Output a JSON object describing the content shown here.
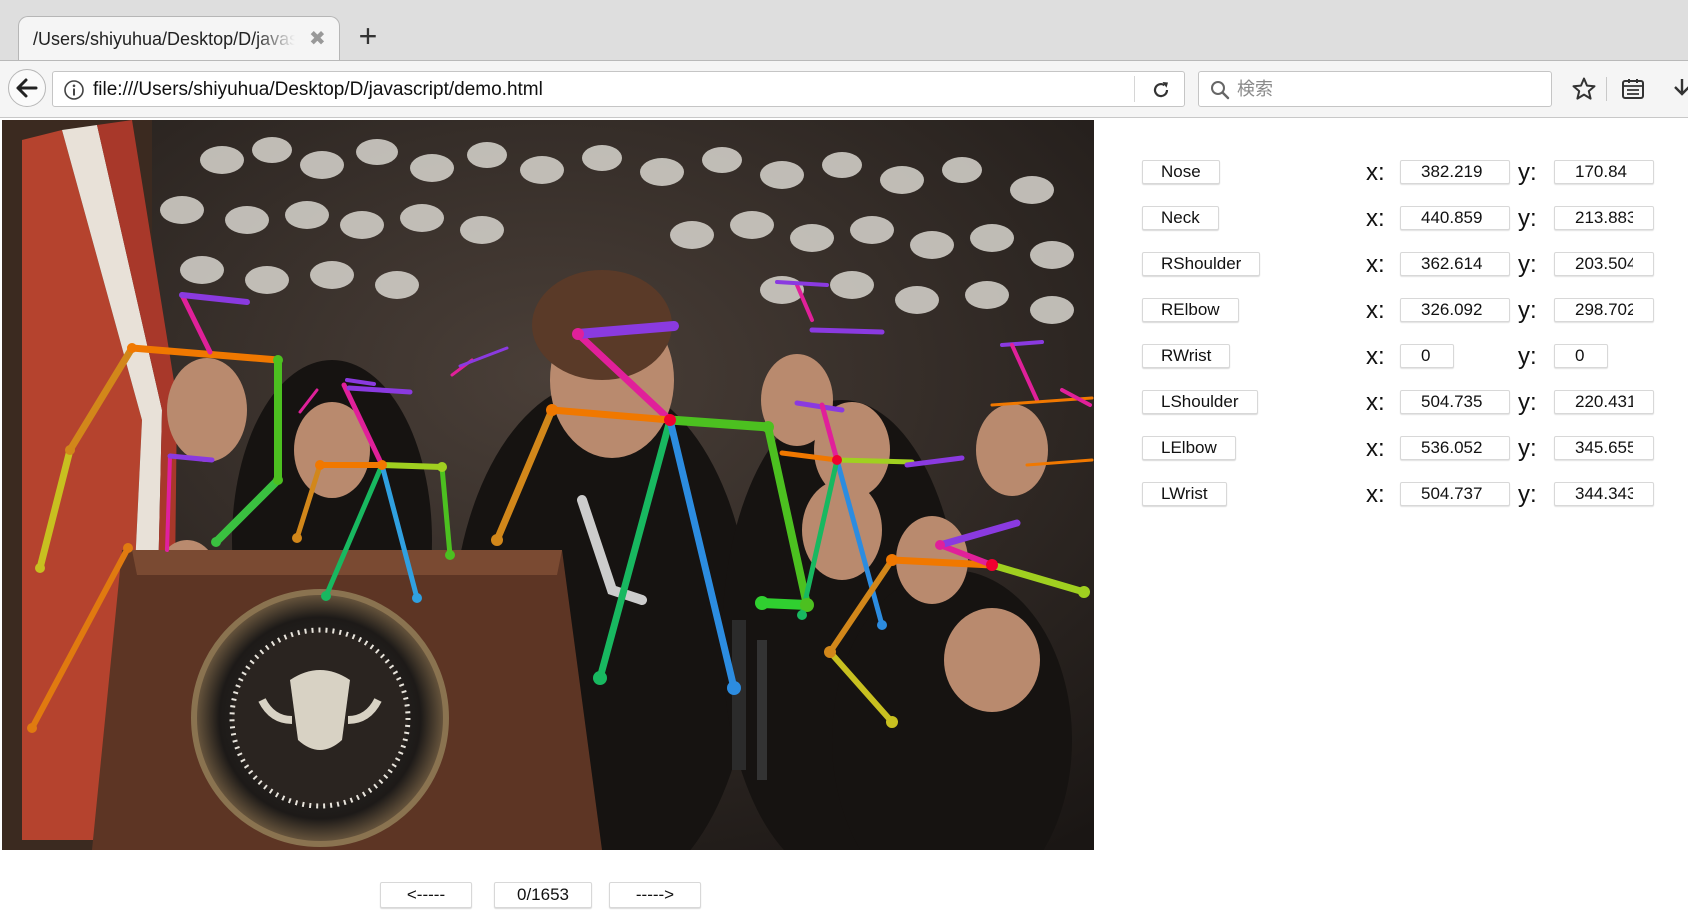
{
  "browser": {
    "tab_title": "/Users/shiyuhua/Desktop/D/javascript/demo.html",
    "tab_close": "✖",
    "new_tab": "+",
    "url": "file:///Users/shiyuhua/Desktop/D/javascript/demo.html",
    "search_placeholder": "検索"
  },
  "keypoints": [
    {
      "name": "Nose",
      "x": "382.219",
      "y": "170.84"
    },
    {
      "name": "Neck",
      "x": "440.859",
      "y": "213.883"
    },
    {
      "name": "RShoulder",
      "x": "362.614",
      "y": "203.504"
    },
    {
      "name": "RElbow",
      "x": "326.092",
      "y": "298.702"
    },
    {
      "name": "RWrist",
      "x": "0",
      "y": "0"
    },
    {
      "name": "LShoulder",
      "x": "504.735",
      "y": "220.431"
    },
    {
      "name": "LElbow",
      "x": "536.052",
      "y": "345.655"
    },
    {
      "name": "LWrist",
      "x": "504.737",
      "y": "344.343"
    }
  ],
  "labels": {
    "x": "x:",
    "y": "y:"
  },
  "navigation": {
    "prev_label": "<-----",
    "frame_counter": "0/1653",
    "next_label": "----->"
  },
  "video_frame": {
    "content": "Photo with pose-estimation skeleton overlays",
    "seal_text": "SEAL OF THE PRESIDENT OF THE UNITED STATES"
  }
}
